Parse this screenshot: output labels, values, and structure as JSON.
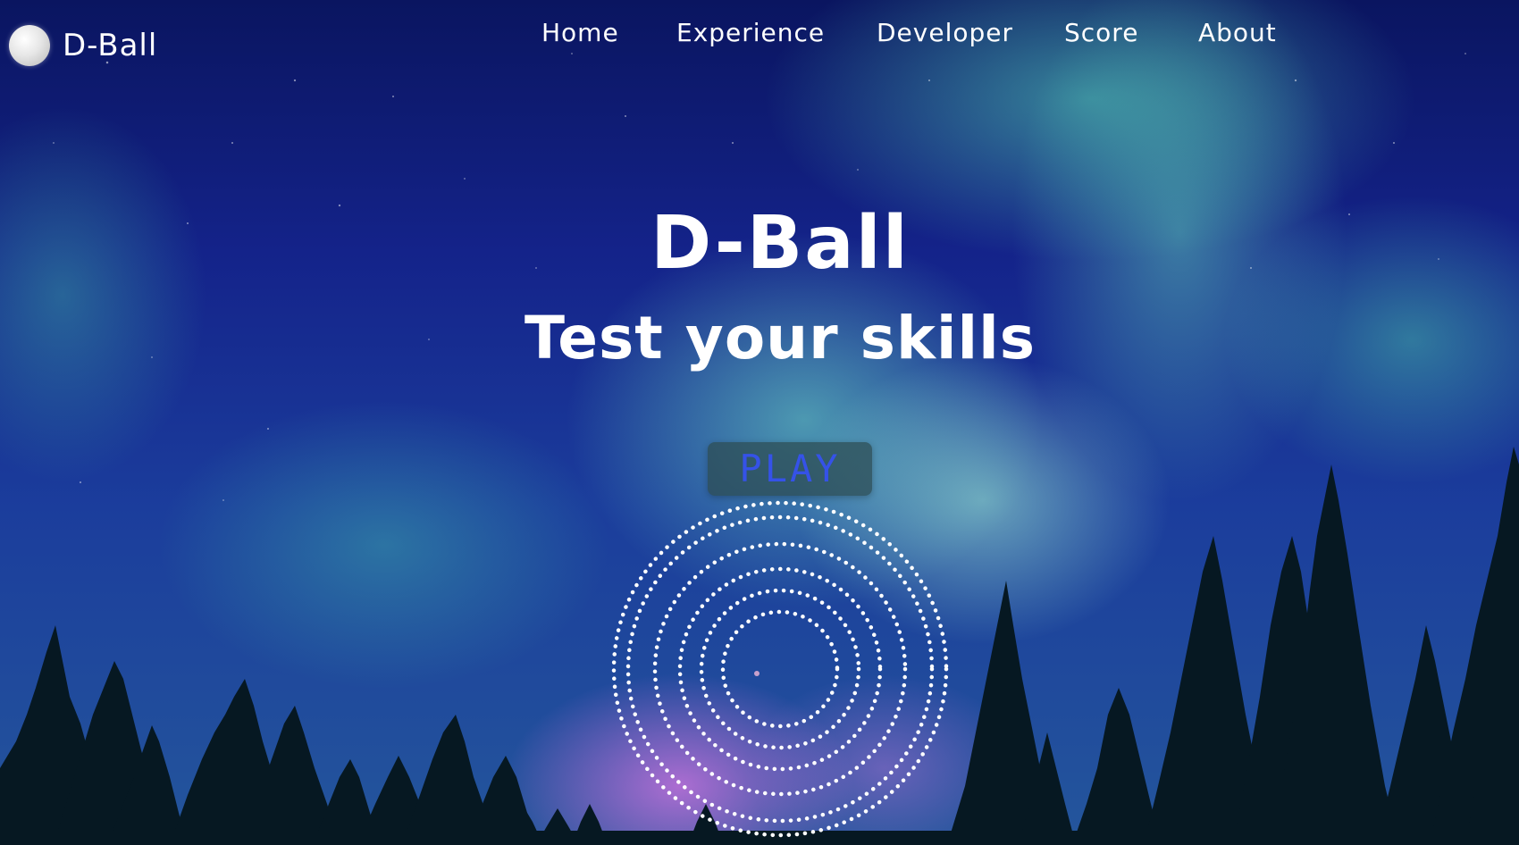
{
  "header": {
    "logo_text": "D-Ball"
  },
  "nav": {
    "items": [
      {
        "label": "Home"
      },
      {
        "label": "Experience"
      },
      {
        "label": "Developer"
      },
      {
        "label": "Score"
      },
      {
        "label": "About"
      }
    ]
  },
  "hero": {
    "title": "D-Ball",
    "subtitle": "Test your skills",
    "play_label": "PLAY"
  },
  "colors": {
    "play_text": "#3552e8",
    "text": "#ffffff",
    "sky_top": "#0a1560",
    "aurora": "#78ebc8"
  },
  "icons": [
    "ball-logo-icon",
    "target-rings-icon"
  ]
}
